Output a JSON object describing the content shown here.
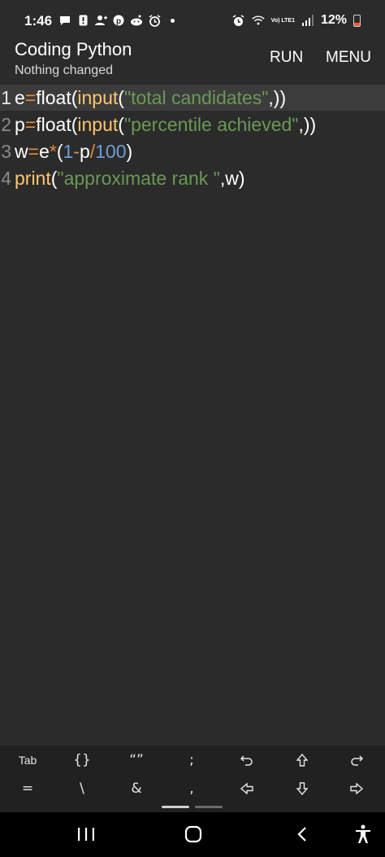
{
  "status_bar": {
    "time": "1:46",
    "battery": "12%",
    "network": "Vo) LTE1",
    "icons_left": [
      "message-icon",
      "notification-icon",
      "person-icon",
      "pinterest-icon",
      "reddit-icon",
      "alarm-icon"
    ],
    "icons_right": [
      "alarm-icon",
      "wifi-icon",
      "signal-icon",
      "battery-icon"
    ]
  },
  "app_bar": {
    "title": "Coding Python",
    "subtitle": "Nothing changed",
    "run_label": "RUN",
    "menu_label": "MENU"
  },
  "editor": {
    "active_line": 1,
    "lines": [
      {
        "number": "1",
        "text": "e=float(input(\"total candidates\",))"
      },
      {
        "number": "2",
        "text": "p=float(input(\"percentile achieved\",))"
      },
      {
        "number": "3",
        "text": "w=e*(1-p/100)"
      },
      {
        "number": "4",
        "text": "print(\"approximate rank \",w)"
      }
    ]
  },
  "extra_keys": {
    "row1": [
      "Tab",
      "{}",
      "“”",
      ";",
      "undo",
      "shift",
      "redo"
    ],
    "row2": [
      "=",
      "\\",
      "&",
      ",",
      "left-arrow",
      "down-arrow",
      "right-arrow"
    ]
  },
  "colors": {
    "background": "#2b2b2b",
    "active_line": "#3c3c3c",
    "keyword_function": "#ffc66d",
    "operator": "#e58a3a",
    "string": "#6a9955",
    "number": "#6a9fd4"
  }
}
